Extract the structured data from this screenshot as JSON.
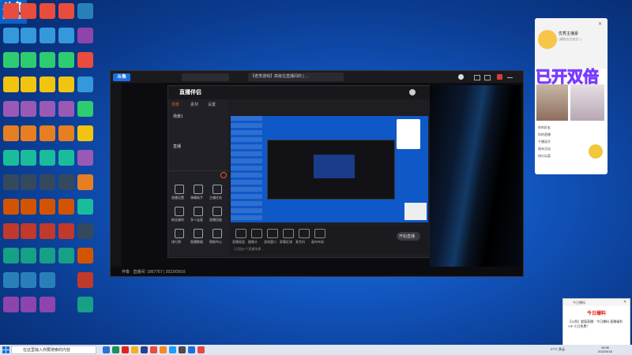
{
  "desktop": {
    "badge_title": "斗鱼",
    "badge_number": "5758086"
  },
  "app_window": {
    "logo": "斗鱼",
    "tab_title": "【老李游戏】高级在直播间的 | ...",
    "status_text": "伴奏 · 直播间: 1867767 | 2022/09/16"
  },
  "stream_panel": {
    "logo_text": "直播伴侣",
    "tabs": [
      "场景",
      "素材",
      "设置"
    ],
    "scene_items": [
      "场景1",
      "直播"
    ],
    "tools": [
      "直播画面",
      "摄像头",
      "游戏窗口",
      "屏幕区域",
      "麦克风",
      "画布布局"
    ],
    "grid_items": [
      "直播设置",
      "弹幕助手",
      "主播任务",
      "粉丝福利",
      "多人连麦",
      "直播回放",
      "排行榜",
      "直播数据",
      "帮助中心"
    ],
    "start_label": "开始直播",
    "overlay_text": "已添加1个直播场景 ..."
  },
  "chat_window": {
    "name": "优秀主播豪",
    "subtitle": "(请你点点关注~)",
    "overlay_big": "已开双倍",
    "lines": [
      "你的好友",
      "你的直播",
      "千播双开",
      "周末活动",
      "快乐玩耍"
    ]
  },
  "popup": {
    "app": "今日爆料",
    "title": "今日爆料",
    "text": "【斗鱼】超值直播：今日爆料 直播福利 VIP 七日免费！"
  },
  "taskbar": {
    "search_placeholder": "在这里输入你要搜索的内容",
    "temperature": "27°C 多云",
    "time": "16:56",
    "date": "2022/9/16"
  },
  "colors": {
    "desktop_blue": "#1257c2",
    "accent_red": "#e2231a",
    "douyu_blue": "#1c6fe0"
  }
}
